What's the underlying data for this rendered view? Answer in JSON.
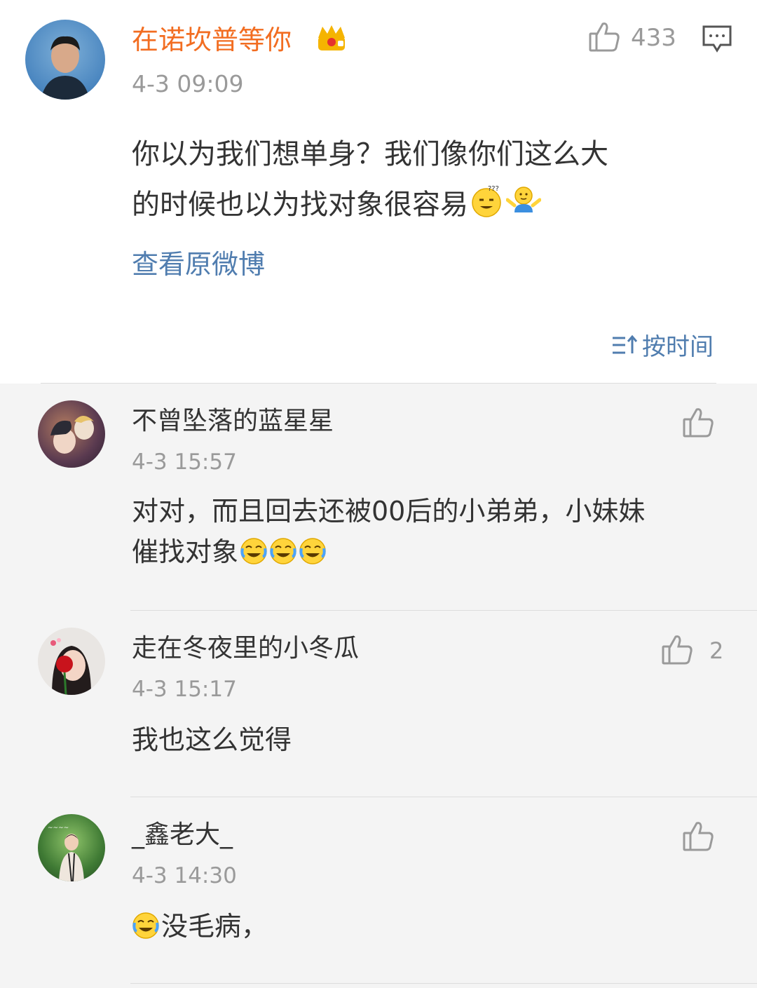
{
  "main_comment": {
    "username": "在诺坎普等你",
    "badge_icon": "crown-icon",
    "time": "4-3 09:09",
    "like_count": "433",
    "text_line1": "你以为我们想单身？我们像你们这么大",
    "text_line2": "的时候也以为找对象很容易",
    "emojis": [
      "confused-smile-emoji",
      "shrug-emoji"
    ],
    "view_original_label": "查看原微博",
    "colors": {
      "username": "#f26d21",
      "link": "#507daf",
      "badge": "#f5b400"
    }
  },
  "sort": {
    "label": "按时间",
    "icon": "sort-icon"
  },
  "replies": [
    {
      "username": "不曾坠落的蓝星星",
      "time": "4-3 15:57",
      "text_line1": "对对，而且回去还被00后的小弟弟，小妹妹",
      "text_line2": "催找对象",
      "emojis": [
        "crying-laughing-emoji",
        "crying-laughing-emoji",
        "crying-laughing-emoji"
      ],
      "like_count": ""
    },
    {
      "username": "走在冬夜里的小冬瓜",
      "time": "4-3 15:17",
      "text_line1": "我也这么觉得",
      "like_count": "2"
    },
    {
      "username": "_鑫老大_",
      "time": "4-3 14:30",
      "emojis_before": [
        "crying-laughing-emoji"
      ],
      "text_line1": "没毛病，",
      "like_count": ""
    }
  ]
}
